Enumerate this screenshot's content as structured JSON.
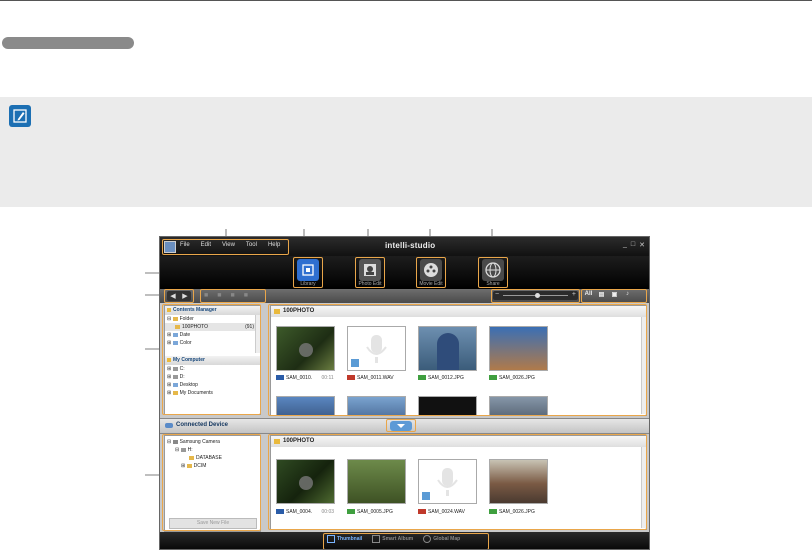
{
  "app": {
    "brand": "intelli-studio",
    "menu": [
      "File",
      "Edit",
      "View",
      "Tool",
      "Help"
    ],
    "window_controls": [
      "_",
      "□",
      "✕"
    ]
  },
  "modes": [
    {
      "label": "Library",
      "icon": "library-icon",
      "color": "#2f6fd0"
    },
    {
      "label": "Photo Edit",
      "icon": "photo-edit-icon",
      "color": "#555555"
    },
    {
      "label": "Movie Edit",
      "icon": "movie-edit-icon",
      "color": "#4a4a4a"
    },
    {
      "label": "Share",
      "icon": "share-globe-icon",
      "color": "#4a4a4a"
    }
  ],
  "view_options": [
    "All",
    "▤",
    "▣",
    "♪"
  ],
  "contents_manager": {
    "title": "Contents Manager",
    "items": [
      {
        "label": "Folder",
        "indent": 0,
        "selected": false,
        "count": ""
      },
      {
        "label": "100PHOTO",
        "indent": 1,
        "selected": true,
        "count": "(91)"
      },
      {
        "label": "Date",
        "indent": 0,
        "selected": false,
        "count": ""
      },
      {
        "label": "Color",
        "indent": 0,
        "selected": false,
        "count": ""
      }
    ]
  },
  "my_computer": {
    "title": "My Computer",
    "items": [
      "C:",
      "D:",
      "Desktop",
      "My Documents"
    ]
  },
  "library_panel": {
    "title": "100PHOTO",
    "files": [
      {
        "name": "SAM_0010.",
        "duration": "00:11",
        "type": "movie",
        "tag_color": "#2a5ca8",
        "art": "dark-green"
      },
      {
        "name": "SAM_0011.WAV",
        "duration": "",
        "type": "audio",
        "tag_color": "#c0392b",
        "art": "mic"
      },
      {
        "name": "SAM_0012.JPG",
        "duration": "",
        "type": "photo",
        "tag_color": "#3f9f3f",
        "art": "door"
      },
      {
        "name": "SAM_0026.JPG",
        "duration": "",
        "type": "photo",
        "tag_color": "#3f9f3f",
        "art": "sky"
      }
    ]
  },
  "connected_device": {
    "title": "Connected Device",
    "tree": [
      {
        "label": "Samsung Camera",
        "indent": 0
      },
      {
        "label": "H:",
        "indent": 1
      },
      {
        "label": "DATABASE",
        "indent": 2
      },
      {
        "label": "DCIM",
        "indent": 2
      }
    ],
    "save_button": "Save New File"
  },
  "device_panel": {
    "title": "100PHOTO",
    "files": [
      {
        "name": "SAM_0004.",
        "duration": "00:03",
        "type": "movie",
        "tag_color": "#2a5ca8",
        "art": "trees"
      },
      {
        "name": "SAM_0005.JPG",
        "duration": "",
        "type": "photo",
        "tag_color": "#3f9f3f",
        "art": "garden"
      },
      {
        "name": "SAM_0024.WAV",
        "duration": "",
        "type": "audio",
        "tag_color": "#c0392b",
        "art": "mic"
      },
      {
        "name": "SAM_0026.JPG",
        "duration": "",
        "type": "photo",
        "tag_color": "#3f9f3f",
        "art": "rails"
      }
    ]
  },
  "bottom_tabs": [
    {
      "label": "Thumbnail",
      "active": true
    },
    {
      "label": "Smart Album",
      "active": false
    },
    {
      "label": "Global Map",
      "active": false
    }
  ]
}
